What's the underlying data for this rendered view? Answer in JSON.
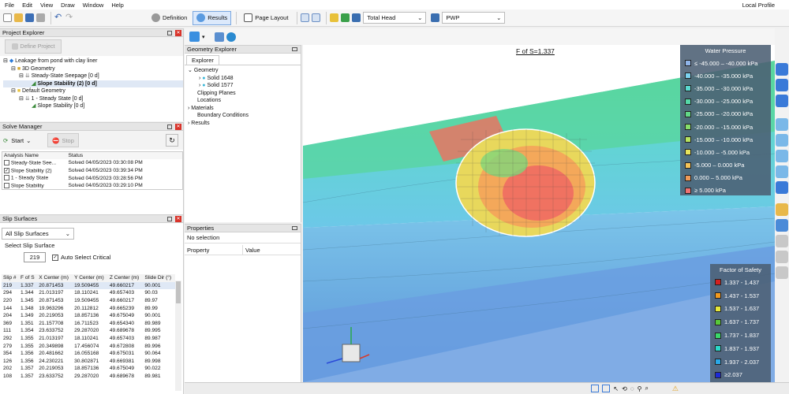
{
  "menu": {
    "items": [
      "File",
      "Edit",
      "View",
      "Draw",
      "Window",
      "Help"
    ],
    "right": "Local Profile"
  },
  "toolbar": {
    "definition": "Definition",
    "results": "Results",
    "page_layout": "Page Layout",
    "result_type": "Total Head",
    "result_set": "PWP"
  },
  "project_explorer": {
    "title": "Project Explorer",
    "define_button": "Define Project",
    "tree": [
      "Leakage from pond with clay liner",
      "3D Geometry",
      "Steady-State Seepage [0 d]",
      "Slope Stability (2) [0 d]",
      "Default Geometry",
      "1 - Steady State [0 d]",
      "Slope Stability [0 d]"
    ]
  },
  "solve_manager": {
    "title": "Solve Manager",
    "start": "Start",
    "stop": "Stop",
    "col_name": "Analysis Name",
    "col_status": "Status",
    "rows": [
      {
        "name": "Steady-State See...",
        "status": "Solved 04/05/2023 03:30:08 PM",
        "checked": false
      },
      {
        "name": "Slope Stability (2)",
        "status": "Solved 04/05/2023 03:39:34 PM",
        "checked": true
      },
      {
        "name": "1 - Steady State",
        "status": "Solved 04/05/2023 03:28:56 PM",
        "checked": false
      },
      {
        "name": "Slope Stability",
        "status": "Solved 04/05/2023 03:29:10 PM",
        "checked": false
      }
    ]
  },
  "slip_surfaces": {
    "title": "Slip Surfaces",
    "filter": "All Slip Surfaces",
    "select_label": "Select Slip Surface",
    "selected": "219",
    "auto_label": "Auto Select Critical",
    "headers": [
      "Slip #",
      "F of S",
      "X Center (m)",
      "Y Center (m)",
      "Z Center (m)",
      "Slide Dir (°)"
    ],
    "rows": [
      [
        "219",
        "1.337",
        "20.871453",
        "19.509455",
        "49.660217",
        "90.001"
      ],
      [
        "294",
        "1.344",
        "21.013197",
        "18.110241",
        "49.657403",
        "90.03"
      ],
      [
        "220",
        "1.345",
        "20.871453",
        "19.509455",
        "49.660217",
        "89.97"
      ],
      [
        "144",
        "1.348",
        "19.963296",
        "20.112812",
        "49.665239",
        "89.99"
      ],
      [
        "204",
        "1.349",
        "20.219053",
        "18.857136",
        "49.675049",
        "90.001"
      ],
      [
        "369",
        "1.351",
        "21.157708",
        "16.711523",
        "49.654340",
        "89.989"
      ],
      [
        "111",
        "1.354",
        "23.633752",
        "29.287020",
        "49.689678",
        "89.995"
      ],
      [
        "292",
        "1.355",
        "21.013197",
        "18.110241",
        "49.657403",
        "89.987"
      ],
      [
        "279",
        "1.355",
        "20.349898",
        "17.456074",
        "49.672808",
        "89.996"
      ],
      [
        "354",
        "1.356",
        "20.481662",
        "16.055168",
        "49.675031",
        "90.064"
      ],
      [
        "126",
        "1.356",
        "24.230221",
        "30.802871",
        "49.669381",
        "89.998"
      ],
      [
        "202",
        "1.357",
        "20.219053",
        "18.857136",
        "49.675049",
        "90.022"
      ],
      [
        "108",
        "1.357",
        "23.633752",
        "29.287020",
        "49.689678",
        "89.981"
      ]
    ]
  },
  "geometry_explorer": {
    "title": "Geometry Explorer",
    "tab": "Explorer",
    "items": [
      "Geometry",
      "Solid 1648",
      "Solid 1577",
      "Clipping Planes",
      "Locations",
      "Materials",
      "Boundary Conditions",
      "Results"
    ]
  },
  "properties": {
    "title": "Properties",
    "selection": "No selection",
    "col_property": "Property",
    "col_value": "Value"
  },
  "view": {
    "fos_label": "F of S=1.337"
  },
  "water_pressure": {
    "title": "Water Pressure",
    "entries": [
      {
        "label": "≤ -45.000 – -40.000 kPa",
        "color": "#8fb4e8"
      },
      {
        "label": "-40.000 – -35.000 kPa",
        "color": "#7cd3f0"
      },
      {
        "label": "-35.000 – -30.000 kPa",
        "color": "#5ad8d0"
      },
      {
        "label": "-30.000 – -25.000 kPa",
        "color": "#55d8a8"
      },
      {
        "label": "-25.000 – -20.000 kPa",
        "color": "#62d887"
      },
      {
        "label": "-20.000 – -15.000 kPa",
        "color": "#86dd6a"
      },
      {
        "label": "-15.000 – -10.000 kPa",
        "color": "#b7e35f"
      },
      {
        "label": "-10.000 – -5.000 kPa",
        "color": "#e7e45c"
      },
      {
        "label": "-5.000 – 0.000 kPa",
        "color": "#f5c458"
      },
      {
        "label": "0.000 – 5.000 kPa",
        "color": "#f09a58"
      },
      {
        "label": "≥ 5.000 kPa",
        "color": "#ef7272"
      }
    ]
  },
  "factor_of_safety": {
    "title": "Factor of Safety",
    "entries": [
      {
        "label": "1.337 - 1.437",
        "color": "#d42020"
      },
      {
        "label": "1.437 - 1.537",
        "color": "#f39a1f"
      },
      {
        "label": "1.537 - 1.637",
        "color": "#e6e83a"
      },
      {
        "label": "1.637 - 1.737",
        "color": "#58c83a"
      },
      {
        "label": "1.737 - 1.837",
        "color": "#3ad86a"
      },
      {
        "label": "1.837 - 1.937",
        "color": "#2ad8c8"
      },
      {
        "label": "1.937 - 2.037",
        "color": "#2aa8e8"
      },
      {
        "label": "≥2.037",
        "color": "#1c2ad8"
      }
    ]
  }
}
